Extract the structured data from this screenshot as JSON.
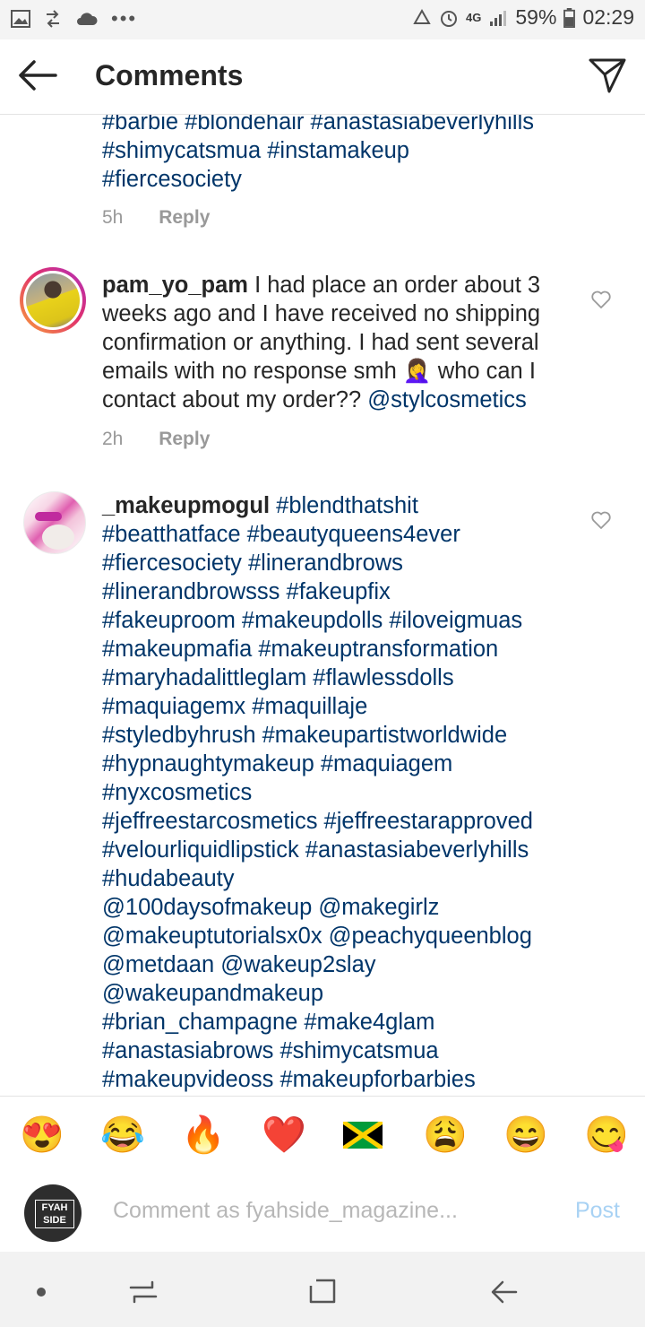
{
  "status_bar": {
    "network": "4G",
    "battery": "59%",
    "time": "02:29"
  },
  "header": {
    "title": "Comments"
  },
  "comments": [
    {
      "partial": true,
      "lines": [
        "#barbie #blondehair #anastasiabeverlyhills",
        "#shimycatsmua #instamakeup",
        "#fiercesociety"
      ],
      "time": "5h",
      "reply_label": "Reply"
    },
    {
      "username": "pam_yo_pam",
      "text_line1": " I had place an order about 3",
      "text_line2": "weeks ago and I have received no shipping",
      "text_line3": "confirmation or anything. I had sent several",
      "text_line4a": "emails with no response smh ",
      "text_line4_emoji": "🤦‍♀️",
      "text_line4b": " who can I",
      "text_line5a": "contact about my order?? ",
      "mention": "@stylcosmetics",
      "time": "2h",
      "reply_label": "Reply"
    },
    {
      "username": "_makeupmogul",
      "first_tag": " #blendthatshit",
      "lines": [
        "#beatthatface #beautyqueens4ever",
        "#fiercesociety #linerandbrows",
        "#linerandbrowsss #fakeupfix",
        "#fakeuproom #makeupdolls #iloveigmuas",
        "#makeupmafia #makeuptransformation",
        "#maryhadalittleglam #flawlessdolls",
        "#maquiagemx #maquillaje",
        "#styledbyhrush #makeupartistworldwide",
        "#hypnaughtymakeup #maquiagem",
        "#nyxcosmetics",
        "#jeffreestarcosmetics #jeffreestarapproved",
        "#velourliquidlipstick #anastasiabeverlyhills",
        "#hudabeauty",
        "@100daysofmakeup @makegirlz",
        "@makeuptutorialsx0x @peachyqueenblog",
        "@metdaan @wakeup2slay",
        "@wakeupandmakeup",
        "#brian_champagne #make4glam",
        "#anastasiabrows  #shimycatsmua",
        "#makeupvideoss #makeupforbarbies"
      ]
    }
  ],
  "emoji_bar": [
    "😍",
    "😂",
    "🔥",
    "❤️",
    "🇯🇲",
    "😩",
    "😄",
    "😋"
  ],
  "composer": {
    "placeholder": "Comment as fyahside_magazine...",
    "post_label": "Post",
    "avatar_text": "FYAH SIDE"
  }
}
